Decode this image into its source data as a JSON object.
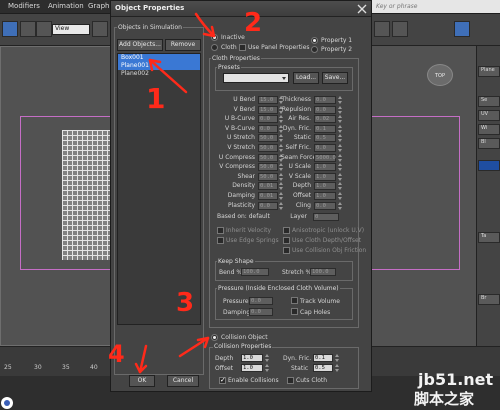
{
  "menubar": [
    "Modifiers",
    "Animation",
    "Graph"
  ],
  "toolbar": {
    "view_select": "View"
  },
  "search": {
    "placeholder": "Key or phrase"
  },
  "viewcube": {
    "label": "TOP"
  },
  "command_panel": {
    "items": [
      "Se",
      "UV",
      "Wi",
      "Bl",
      "Ta",
      "Br"
    ],
    "object_name": "Plane"
  },
  "timeline": {
    "ticks": [
      "25",
      "30",
      "35",
      "40"
    ]
  },
  "dialog": {
    "title": "Object Properties",
    "objects_group_label": "Objects in Simulation",
    "add_objects": "Add Objects...",
    "remove": "Remove",
    "objects": [
      "Box001",
      "Plane001",
      "Plane002"
    ],
    "inactive": "Inactive",
    "cloth": "Cloth",
    "use_panel_properties": "Use Panel Properties",
    "property1": "Property 1",
    "property2": "Property 2",
    "cloth_properties": "Cloth Properties",
    "presets": "Presets",
    "load": "Load...",
    "save": "Save...",
    "left_params": [
      {
        "label": "U Bend",
        "value": "15.0"
      },
      {
        "label": "V Bend",
        "value": "15.0"
      },
      {
        "label": "U B-Curve",
        "value": "0.0"
      },
      {
        "label": "V B-Curve",
        "value": "0.0"
      },
      {
        "label": "U Stretch",
        "value": "50.0"
      },
      {
        "label": "V Stretch",
        "value": "50.0"
      },
      {
        "label": "U Compress",
        "value": "50.0"
      },
      {
        "label": "V Compress",
        "value": "50.0"
      },
      {
        "label": "Shear",
        "value": "50.0"
      },
      {
        "label": "Density",
        "value": "0.01"
      },
      {
        "label": "Damping",
        "value": "0.01"
      },
      {
        "label": "Plasticity",
        "value": "0.0"
      }
    ],
    "right_params": [
      {
        "label": "Thickness",
        "value": "0.0"
      },
      {
        "label": "Repulsion",
        "value": "0.0"
      },
      {
        "label": "Air Res.",
        "value": "0.02"
      },
      {
        "label": "Dyn. Fric.",
        "value": "0.1"
      },
      {
        "label": "Static",
        "value": "0.5"
      },
      {
        "label": "Self Fric.",
        "value": "0.0"
      },
      {
        "label": "Seam Force",
        "value": "5000.0"
      },
      {
        "label": "U Scale",
        "value": "1.0"
      },
      {
        "label": "V Scale",
        "value": "1.0"
      },
      {
        "label": "Depth",
        "value": "1.0"
      },
      {
        "label": "Offset",
        "value": "1.0"
      },
      {
        "label": "Cling",
        "value": "0.0"
      }
    ],
    "based_on": "Based on: default",
    "layer_label": "Layer",
    "layer_value": "0",
    "inherit_velocity": "Inherit Velocity",
    "anisotropic": "Anisotropic (unlock U,V)",
    "use_edge_springs": "Use Edge Springs",
    "use_cloth_depth_offset": "Use Cloth Depth/Offset",
    "use_collision_obj_friction": "Use Collision Obj Friction",
    "keep_shape": "Keep Shape",
    "bend_pct": "Bend %",
    "bend_value": "100.0",
    "stretch_pct": "Stretch %",
    "stretch_value": "100.0",
    "pressure_group": "Pressure (Inside Enclosed Cloth Volume)",
    "pressure": "Pressure",
    "pressure_value": "0.0",
    "track_volume": "Track Volume",
    "pdamping": "Damping",
    "pdamping_value": "0.0",
    "cap_holes": "Cap Holes",
    "collision_object": "Collision Object",
    "collision_properties": "Collision Properties",
    "c_depth": "Depth",
    "c_depth_value": "1.0",
    "c_offset": "Offset",
    "c_offset_value": "1.0",
    "c_dyn_fric": "Dyn. Fric.",
    "c_dyn_fric_value": "0.1",
    "c_static": "Static",
    "c_static_value": "0.5",
    "enable_collisions": "Enable Collisions",
    "cuts_cloth": "Cuts Cloth",
    "ok": "OK",
    "cancel": "Cancel"
  },
  "annotations": {
    "n1": "1",
    "n2": "2",
    "n3": "3",
    "n4": "4"
  },
  "watermark": {
    "line1": "jb51.net",
    "line2": "脚本之家"
  },
  "colors": {
    "annotation": "#ff2a1a",
    "selection": "#3a78d4",
    "dialog_bg": "#444444"
  }
}
